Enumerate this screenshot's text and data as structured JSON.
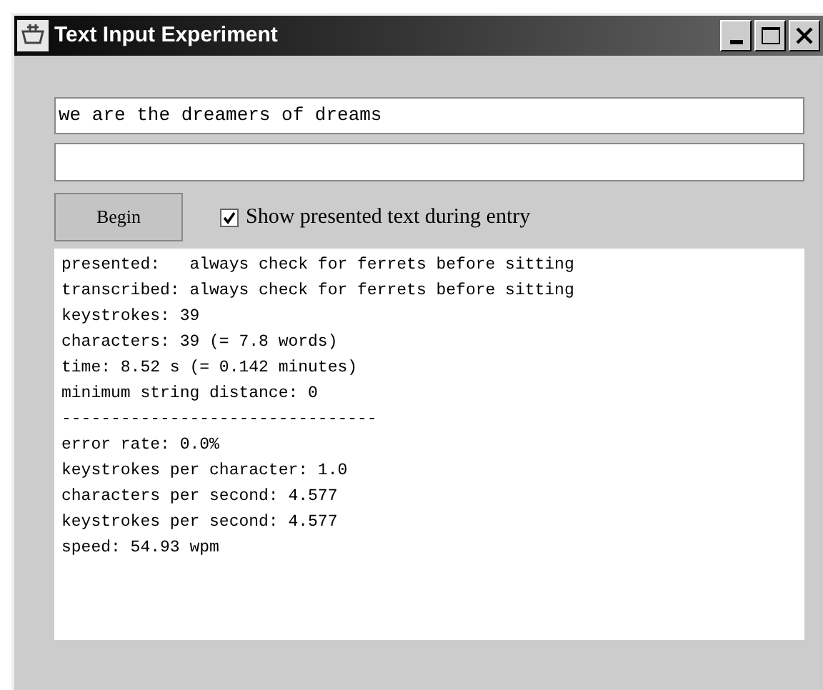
{
  "window": {
    "title": "Text Input Experiment"
  },
  "presented_field": {
    "value": "we are the dreamers of dreams"
  },
  "begin_button": {
    "label": "Begin"
  },
  "show_presented": {
    "label": "Show presented text during entry",
    "checked": true
  },
  "output": [
    "presented:   always check for ferrets before sitting",
    "transcribed: always check for ferrets before sitting",
    "keystrokes: 39",
    "characters: 39 (= 7.8 words)",
    "time: 8.52 s (= 0.142 minutes)",
    "minimum string distance: 0",
    "--------------------------------",
    "error rate: 0.0%",
    "keystrokes per character: 1.0",
    "characters per second: 4.577",
    "keystrokes per second: 4.577",
    "speed: 54.93 wpm"
  ]
}
